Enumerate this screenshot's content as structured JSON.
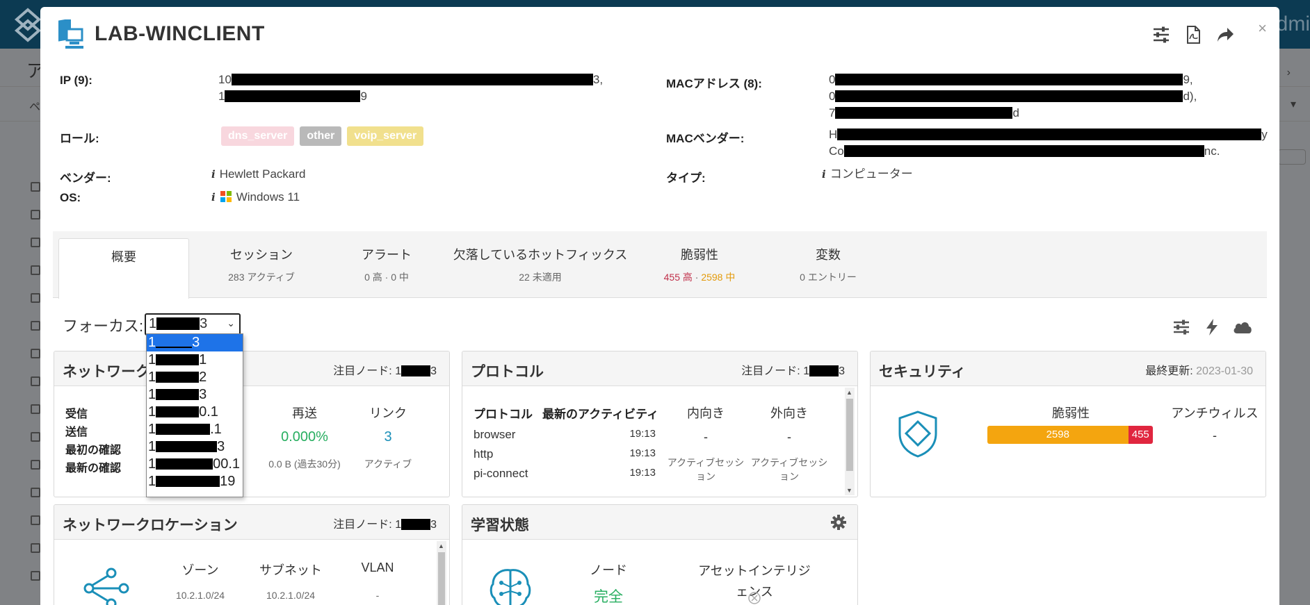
{
  "background": {
    "page_title_char": "ア",
    "sub_char": "ペ",
    "user_fragment": "dmi"
  },
  "modal": {
    "title": "LAB-WINCLIENT",
    "close_label": "×",
    "info": {
      "ip_label": "IP (9):",
      "ip_line1_start": "10",
      "ip_line1_end": "3,",
      "ip_line2_start": "1",
      "ip_line2_end": "9",
      "mac_label": "MACアドレス (8):",
      "mac_line1_start": "0",
      "mac_line1_end": "9,",
      "mac_line2_start": "0",
      "mac_line2_end": "d),",
      "mac_line3_start": "7",
      "mac_line3_end": "d",
      "role_label": "ロール:",
      "roles": [
        "dns_server",
        "other",
        "voip_server"
      ],
      "mac_vendor_label": "MACベンダー:",
      "mac_vendor_line1_start": "H",
      "mac_vendor_line1_end": "y",
      "mac_vendor_line2_start": "Co",
      "mac_vendor_line2_end": "nc.",
      "vendor_label": "ベンダー:",
      "vendor_value": "Hewlett Packard",
      "type_label": "タイプ:",
      "type_value": "コンピューター",
      "os_label": "OS:",
      "os_value": "Windows 11",
      "info_glyph": "i"
    },
    "tabs": [
      {
        "label": "概要",
        "sub": ""
      },
      {
        "label": "セッション",
        "sub": "283 アクティブ"
      },
      {
        "label": "アラート",
        "sub": "0 高 · 0 中"
      },
      {
        "label": "欠落しているホットフィックス",
        "sub": "22 未適用"
      },
      {
        "label": "脆弱性",
        "sub_red": "455 高",
        "sub_sep": " · ",
        "sub_orange": "2598 中"
      },
      {
        "label": "変数",
        "sub": "0 エントリー"
      }
    ],
    "focus": {
      "label": "フォーカス:",
      "selected_start": "1",
      "selected_end": "3",
      "options": [
        {
          "start": "1",
          "end": "3"
        },
        {
          "start": "1",
          "end": "1"
        },
        {
          "start": "1",
          "end": "2"
        },
        {
          "start": "1",
          "end": "3"
        },
        {
          "start": "1",
          "end": "0.1"
        },
        {
          "start": "1",
          "end": ".1"
        },
        {
          "start": "1",
          "end": "3"
        },
        {
          "start": "1",
          "end": "00.1"
        },
        {
          "start": "1",
          "end": "19"
        }
      ]
    },
    "network_card": {
      "title": "ネットワーク",
      "meta_label": "注目ノード: ",
      "meta_start": "1",
      "meta_end": "3",
      "rows": [
        "受信",
        "送信",
        "最初の確認",
        "最新の確認"
      ],
      "retrans_head": "再送",
      "retrans_value": "0.000%",
      "retrans_sub": "0.0 B (過去30分)",
      "link_head": "リンク",
      "link_value": "3",
      "link_sub": "アクティブ"
    },
    "protocol_card": {
      "title": "プロトコル",
      "meta_label": "注目ノード: ",
      "meta_start": "1",
      "meta_end": "3",
      "col_protocol": "プロトコル",
      "col_activity": "最新のアクティビティ",
      "rows": [
        {
          "name": "browser",
          "time": "19:13"
        },
        {
          "name": "http",
          "time": "19:13"
        },
        {
          "name": "pi-connect",
          "time": "19:13"
        }
      ],
      "inbound_head": "内向き",
      "inbound_value": "-",
      "inbound_sub_1": "アクティブセッシ",
      "inbound_sub_2": "ョン",
      "outbound_head": "外向き",
      "outbound_value": "-",
      "outbound_sub_1": "アクティブセッシ",
      "outbound_sub_2": "ョン"
    },
    "security_card": {
      "title": "セキュリティ",
      "meta_label": "最終更新: ",
      "meta_date": "2023-01-30",
      "vuln_head": "脆弱性",
      "vuln_medium": 2598,
      "vuln_high": 455,
      "vuln_medium_color": "#f4a50f",
      "vuln_high_color": "#e0263f",
      "antivirus_head": "アンチウィルス",
      "antivirus_value": "-"
    },
    "location_card": {
      "title": "ネットワークロケーション",
      "meta_label": "注目ノード: ",
      "meta_start": "1",
      "meta_end": "3",
      "zone_head": "ゾーン",
      "zone_value": "10.2.1.0/24",
      "subnet_head": "サブネット",
      "subnet_value": "10.2.1.0/24",
      "vlan_head": "VLAN",
      "vlan_value": "-"
    },
    "learning_card": {
      "title": "学習状態",
      "node_head": "ノード",
      "node_value": "完全",
      "intel_head_1": "アセットインテリジ",
      "intel_head_2": "ェンス"
    }
  }
}
